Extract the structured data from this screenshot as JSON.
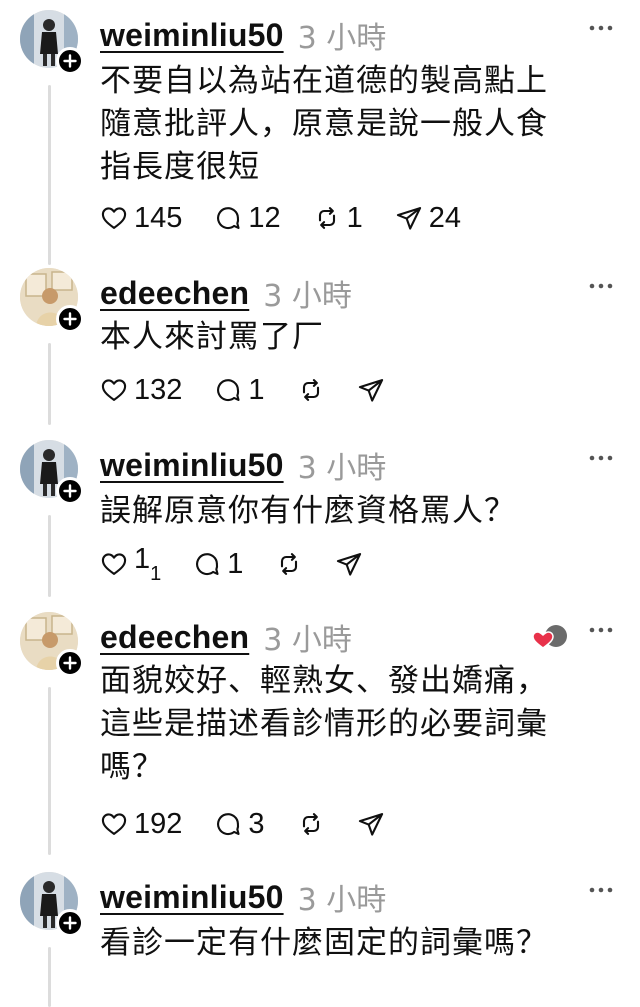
{
  "posts": [
    {
      "username": "weiminliu50",
      "time": "3 小時",
      "lines": [
        "不要自以為站在道德的製高點上",
        "隨意批評人，原意是說一般人食",
        "指長度很短"
      ],
      "likes": "145",
      "replies": "12",
      "reposts": "1",
      "shares": "24",
      "avatar_icon": "avatar-person-icon"
    },
    {
      "username": "edeechen",
      "time": "3 小時",
      "lines": [
        "本人來討罵了厂"
      ],
      "likes": "132",
      "replies": "1",
      "reposts": "",
      "shares": "",
      "avatar_icon": "avatar-person-icon"
    },
    {
      "username": "weiminliu50",
      "time": "3 小時",
      "lines": [
        "誤解原意你有什麼資格罵人？"
      ],
      "likes": "1",
      "likes_sub": "1",
      "replies": "1",
      "reposts": "",
      "shares": "",
      "avatar_icon": "avatar-person-icon"
    },
    {
      "username": "edeechen",
      "time": "3 小時",
      "lines": [
        "面貌姣好、輕熟女、發出嬌痛，",
        "這些是描述看診情形的必要詞彙",
        "嗎？"
      ],
      "likes": "192",
      "replies": "3",
      "reposts": "",
      "shares": "",
      "avatar_icon": "avatar-person-icon"
    },
    {
      "username": "weiminliu50",
      "time": "3 小時",
      "lines": [
        "看診一定有什麼固定的詞彙嗎？"
      ],
      "avatar_icon": "avatar-person-icon"
    }
  ],
  "colors": {
    "text": "#101010",
    "muted": "#9a9a9a",
    "line": "#dcdcdc",
    "heart": "#e8314a"
  }
}
